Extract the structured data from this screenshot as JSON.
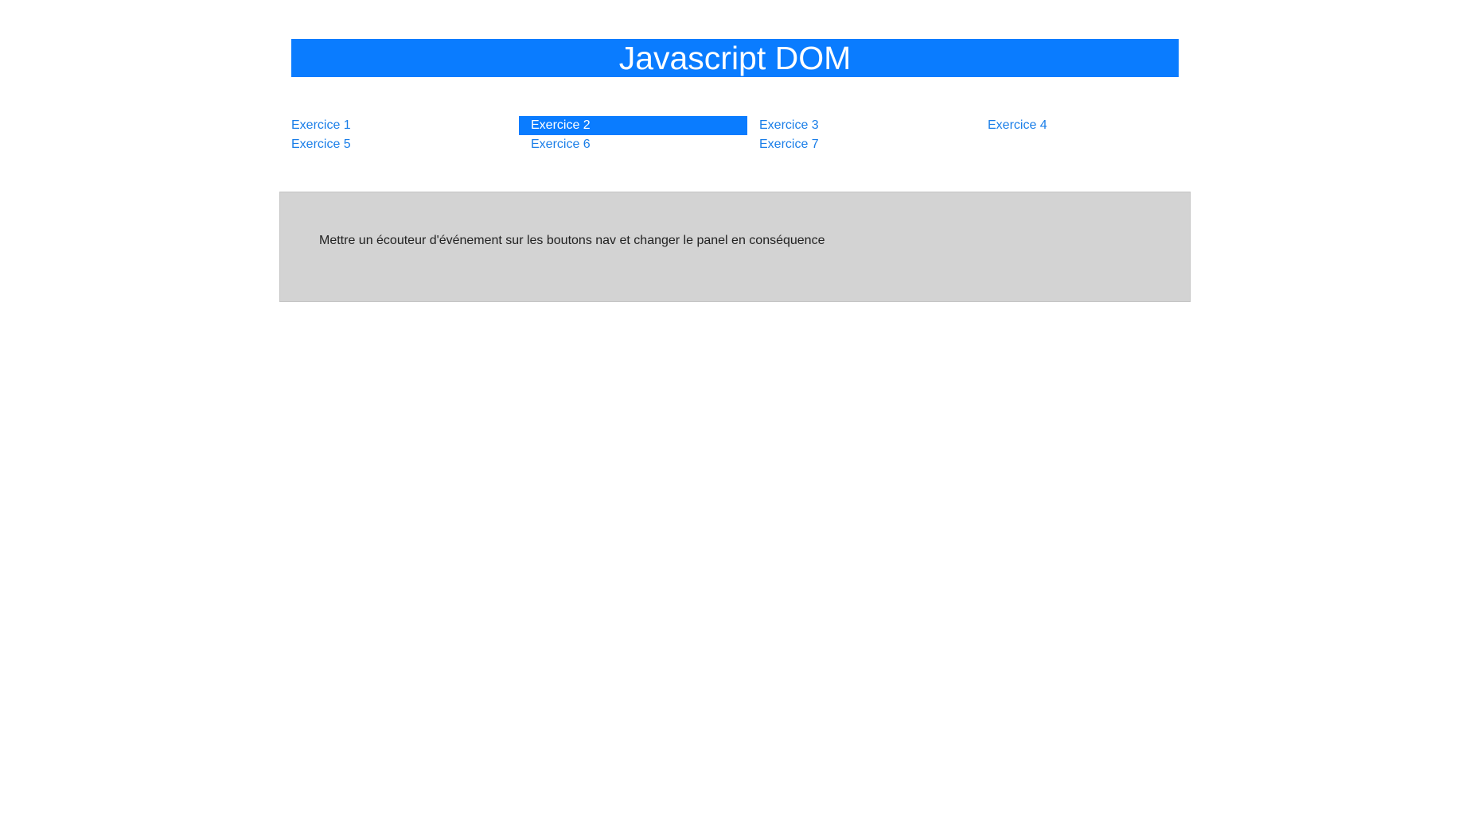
{
  "header": {
    "title": "Javascript DOM"
  },
  "nav": {
    "items": [
      {
        "label": "Exercice 1",
        "active": false
      },
      {
        "label": "Exercice 2",
        "active": true
      },
      {
        "label": "Exercice 3",
        "active": false
      },
      {
        "label": "Exercice 4",
        "active": false
      },
      {
        "label": "Exercice 5",
        "active": false
      },
      {
        "label": "Exercice 6",
        "active": false
      },
      {
        "label": "Exercice 7",
        "active": false
      }
    ]
  },
  "panel": {
    "text": "Mettre un écouteur d'événement sur les boutons nav et changer le panel en conséquence"
  },
  "colors": {
    "accent": "#0a7cff",
    "link": "#1a7ee8",
    "panel_bg": "#d3d3d3"
  }
}
